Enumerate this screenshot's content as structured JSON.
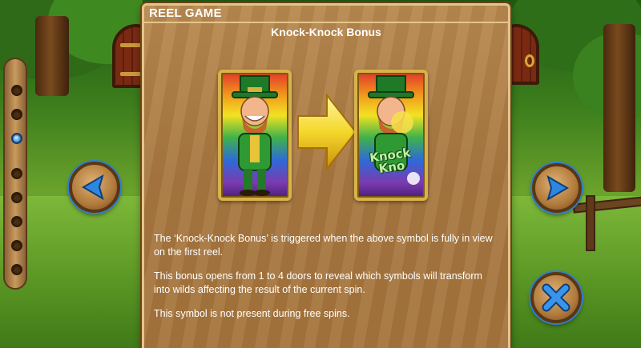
{
  "section": {
    "title": "REEL GAME"
  },
  "bonus": {
    "title": "Knock-Knock Bonus"
  },
  "symbols": {
    "before_icon": "leprechaun-symbol-icon",
    "transform_icon": "arrow-right-icon",
    "after_icon": "leprechaun-knock-knock-symbol-icon",
    "after_overlay_text": "Knock Kno"
  },
  "paragraphs": [
    "The ‘Knock-Knock Bonus’ is triggered when the above symbol is fully in view on the first reel.",
    "This bonus opens from 1 to 4 doors to reveal which symbols will transform into wilds affecting the result of the current spin.",
    "This symbol is not present during free spins."
  ],
  "pagination": {
    "total_pages": 8,
    "current_page": 3
  },
  "nav": {
    "prev_icon": "arrow-left-icon",
    "next_icon": "arrow-right-icon",
    "close_icon": "close-icon"
  },
  "colors": {
    "panel": "#a8773f",
    "panel_border": "#e4c58a",
    "text": "#ffffff",
    "nav_arrow": "#2f7fd0",
    "rail_active": "#58a7e6",
    "arrow_gold": "#f5d72a"
  }
}
